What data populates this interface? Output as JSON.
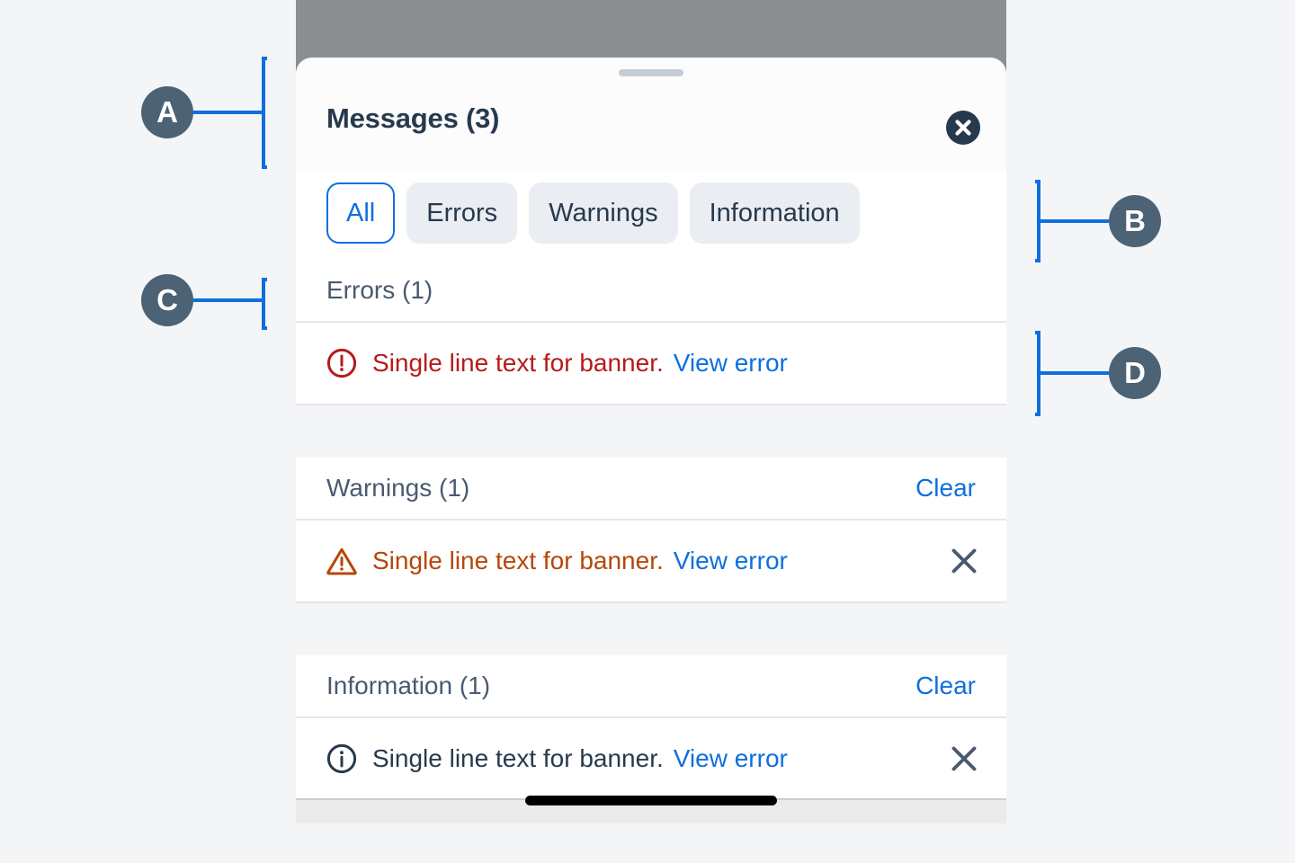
{
  "sheet": {
    "title": "Messages (3)",
    "close_icon": "close-circle-icon",
    "drag_handle": "drag-handle"
  },
  "filters": [
    {
      "label": "All",
      "selected": true
    },
    {
      "label": "Errors",
      "selected": false
    },
    {
      "label": "Warnings",
      "selected": false
    },
    {
      "label": "Information",
      "selected": false
    }
  ],
  "sections": [
    {
      "title": "Errors (1)",
      "clear_label": "",
      "has_clear": false,
      "icon": "error-circle-icon",
      "message": "Single line text for banner.",
      "link_label": "View error",
      "has_dismiss": false
    },
    {
      "title": "Warnings (1)",
      "clear_label": "Clear",
      "has_clear": true,
      "icon": "warning-triangle-icon",
      "message": "Single line text for banner.",
      "link_label": "View error",
      "has_dismiss": true
    },
    {
      "title": "Information (1)",
      "clear_label": "Clear",
      "has_clear": true,
      "icon": "info-circle-icon",
      "message": "Single line text for banner.",
      "link_label": "View error",
      "has_dismiss": true
    }
  ],
  "annotations": [
    {
      "label": "A"
    },
    {
      "label": "B"
    },
    {
      "label": "C"
    },
    {
      "label": "D"
    }
  ],
  "colors": {
    "accent_blue": "#0f6fde",
    "error_red": "#b51b1b",
    "warning_orange": "#b54708",
    "text_navy": "#27394d",
    "marker_slate": "#4c6275",
    "page_bg": "#f4f5f7"
  }
}
